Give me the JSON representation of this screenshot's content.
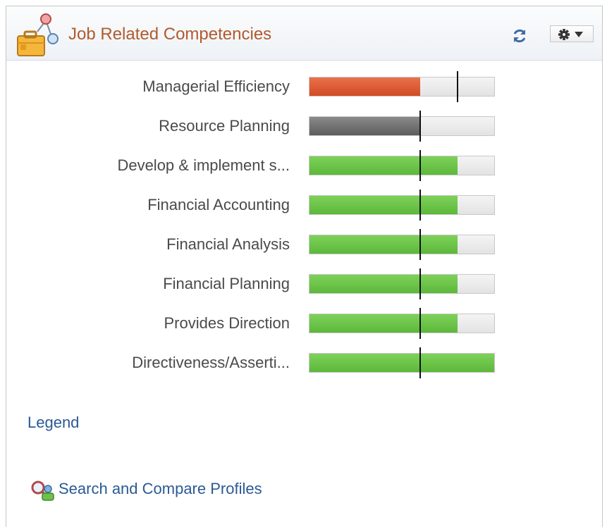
{
  "header": {
    "title": "Job Related Competencies",
    "icon": "briefcase-network-icon",
    "refresh_icon": "refresh-icon",
    "actions_icon": "gear-dropdown-icon"
  },
  "competencies": [
    {
      "label": "Managerial Efficiency",
      "actual": 0.6,
      "target": 0.8,
      "status": "red"
    },
    {
      "label": "Resource Planning",
      "actual": 0.6,
      "target": 0.6,
      "status": "gray"
    },
    {
      "label": "Develop & implement s...",
      "actual": 0.8,
      "target": 0.6,
      "status": "green"
    },
    {
      "label": "Financial Accounting",
      "actual": 0.8,
      "target": 0.6,
      "status": "green"
    },
    {
      "label": "Financial Analysis",
      "actual": 0.8,
      "target": 0.6,
      "status": "green"
    },
    {
      "label": "Financial Planning",
      "actual": 0.8,
      "target": 0.6,
      "status": "green"
    },
    {
      "label": "Provides Direction",
      "actual": 0.8,
      "target": 0.6,
      "status": "green"
    },
    {
      "label": "Directiveness/Asserti...",
      "actual": 1.0,
      "target": 0.6,
      "status": "green"
    }
  ],
  "colors": {
    "red": "#d24b23",
    "gray": "#6b6b6b",
    "green": "#5cb83a",
    "title": "#b25a2e",
    "link": "#2a5a96"
  },
  "links": {
    "legend": "Legend",
    "search_compare": "Search and Compare Profiles",
    "search_icon": "search-profiles-icon"
  }
}
